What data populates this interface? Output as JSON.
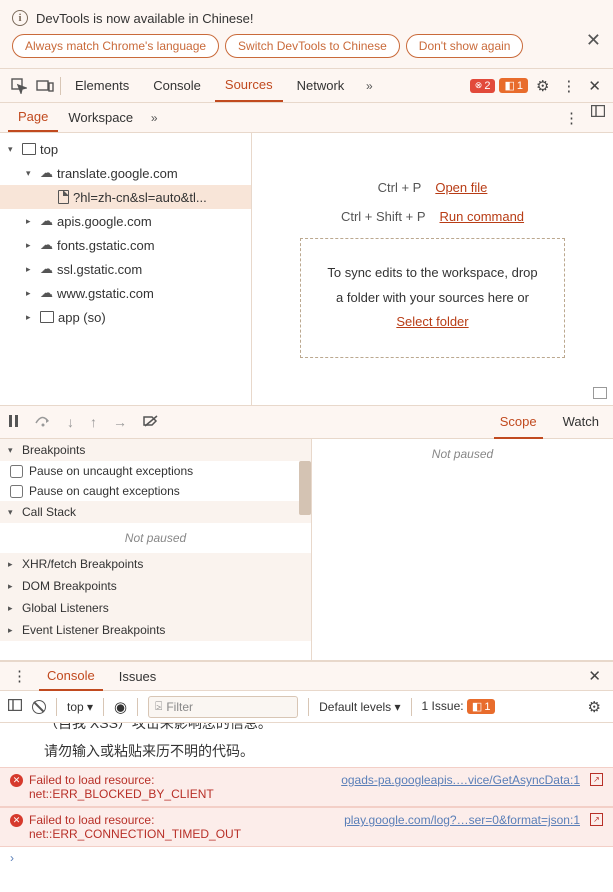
{
  "banner": {
    "title": "DevTools is now available in Chinese!",
    "buttons": [
      "Always match Chrome's language",
      "Switch DevTools to Chinese",
      "Don't show again"
    ]
  },
  "mainTabs": {
    "items": [
      "Elements",
      "Console",
      "Sources",
      "Network"
    ],
    "activeIndex": 2,
    "errors": "2",
    "warnings": "1"
  },
  "subTabs": {
    "items": [
      "Page",
      "Workspace"
    ],
    "activeIndex": 0
  },
  "tree": {
    "top": "top",
    "nodes": [
      {
        "label": "translate.google.com",
        "icon": "cloud",
        "tw": "▾",
        "indent": 1
      },
      {
        "label": "?hl=zh-cn&sl=auto&tl...",
        "icon": "file",
        "tw": "",
        "indent": 2,
        "selected": true
      },
      {
        "label": "apis.google.com",
        "icon": "cloud",
        "tw": "▸",
        "indent": 1
      },
      {
        "label": "fonts.gstatic.com",
        "icon": "cloud",
        "tw": "▸",
        "indent": 1
      },
      {
        "label": "ssl.gstatic.com",
        "icon": "cloud",
        "tw": "▸",
        "indent": 1
      },
      {
        "label": "www.gstatic.com",
        "icon": "cloud",
        "tw": "▸",
        "indent": 1
      },
      {
        "label": "app (so)",
        "icon": "box",
        "tw": "▸",
        "indent": 1
      }
    ]
  },
  "editor": {
    "shortcut1_keys": "Ctrl + P",
    "shortcut1_link": "Open file",
    "shortcut2_keys": "Ctrl + Shift + P",
    "shortcut2_link": "Run command",
    "dropzone_line1": "To sync edits to the workspace, drop",
    "dropzone_line2": "a folder with your sources here or",
    "dropzone_link": "Select folder"
  },
  "scope": {
    "tabs": [
      "Scope",
      "Watch"
    ],
    "activeIndex": 0,
    "notPaused": "Not paused"
  },
  "debugger": {
    "sections": {
      "breakpoints": "Breakpoints",
      "pause_uncaught": "Pause on uncaught exceptions",
      "pause_caught": "Pause on caught exceptions",
      "callstack": "Call Stack",
      "callstack_msg": "Not paused",
      "xhr": "XHR/fetch Breakpoints",
      "dom": "DOM Breakpoints",
      "global": "Global Listeners",
      "event": "Event Listener Breakpoints"
    }
  },
  "consoleTabs": {
    "items": [
      "Console",
      "Issues"
    ],
    "activeIndex": 0
  },
  "consoleToolbar": {
    "context": "top",
    "filter_placeholder": "Filter",
    "levels": "Default levels",
    "issues_label": "1 Issue:",
    "issues_count": "1"
  },
  "consoleBody": {
    "cn_line1": "请勿输入或粘贴来历不明的代码。",
    "errors": [
      {
        "msg": "Failed to load resource:",
        "detail": "net::ERR_BLOCKED_BY_CLIENT",
        "link": "ogads-pa.googleapis.…vice/GetAsyncData:1"
      },
      {
        "msg": "Failed to load resource:",
        "detail": "net::ERR_CONNECTION_TIMED_OUT",
        "link": "play.google.com/log?…ser=0&format=json:1"
      }
    ]
  }
}
